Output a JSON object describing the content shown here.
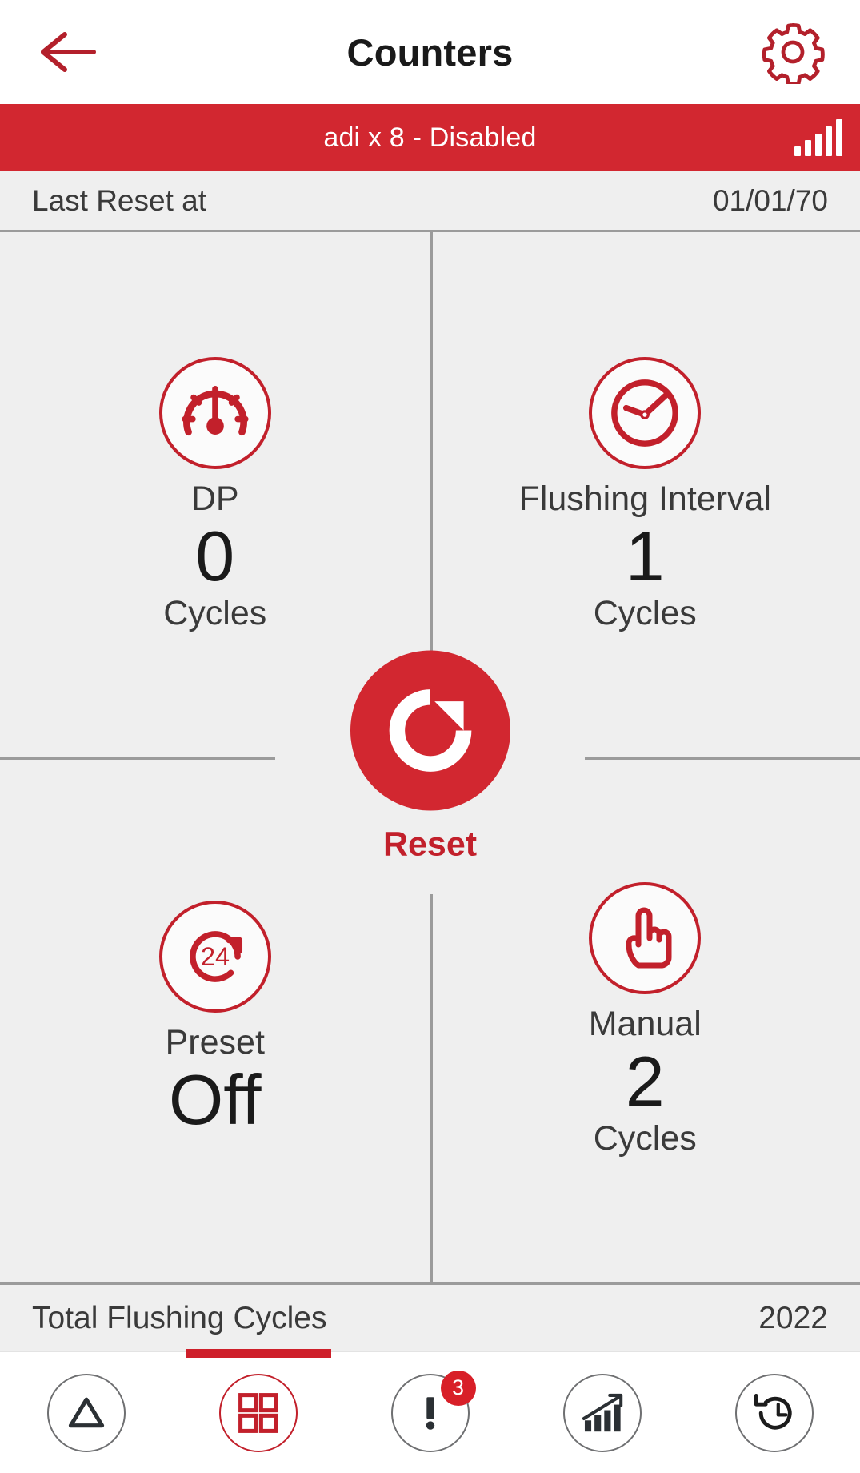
{
  "header": {
    "title": "Counters",
    "back_icon": "arrow-left-icon",
    "settings_icon": "gear-icon"
  },
  "banner": {
    "text": "adi x 8 - Disabled",
    "signal_icon": "signal-bars-icon",
    "color": "#D22730"
  },
  "last_reset": {
    "label": "Last Reset at",
    "value": "01/01/70"
  },
  "counters": [
    {
      "icon": "pressure-gauge-icon",
      "label": "DP",
      "value": "0",
      "unit": "Cycles"
    },
    {
      "icon": "clock-icon",
      "label": "Flushing Interval",
      "value": "1",
      "unit": "Cycles"
    },
    {
      "icon": "preset-24-icon",
      "label": "Preset",
      "value": "Off",
      "unit": ""
    },
    {
      "icon": "hand-pointer-icon",
      "label": "Manual",
      "value": "2",
      "unit": "Cycles"
    }
  ],
  "reset": {
    "label": "Reset",
    "icon": "refresh-icon",
    "color": "#D22730"
  },
  "total": {
    "label": "Total Flushing Cycles",
    "value": "2022"
  },
  "nav": {
    "active_index": 1,
    "items": [
      {
        "icon": "triangle-alert-icon",
        "badge": ""
      },
      {
        "icon": "grid-dashboard-icon",
        "badge": ""
      },
      {
        "icon": "exclamation-icon",
        "badge": "3"
      },
      {
        "icon": "bar-chart-trend-icon",
        "badge": ""
      },
      {
        "icon": "history-clock-icon",
        "badge": ""
      }
    ]
  },
  "colors": {
    "brand_red": "#D22730",
    "icon_red": "#C2202B",
    "page_bg": "#EFEFEF",
    "divider": "#9b9b9b",
    "text_dark": "#1a1a1a",
    "text_gray": "#3a3a3a"
  }
}
